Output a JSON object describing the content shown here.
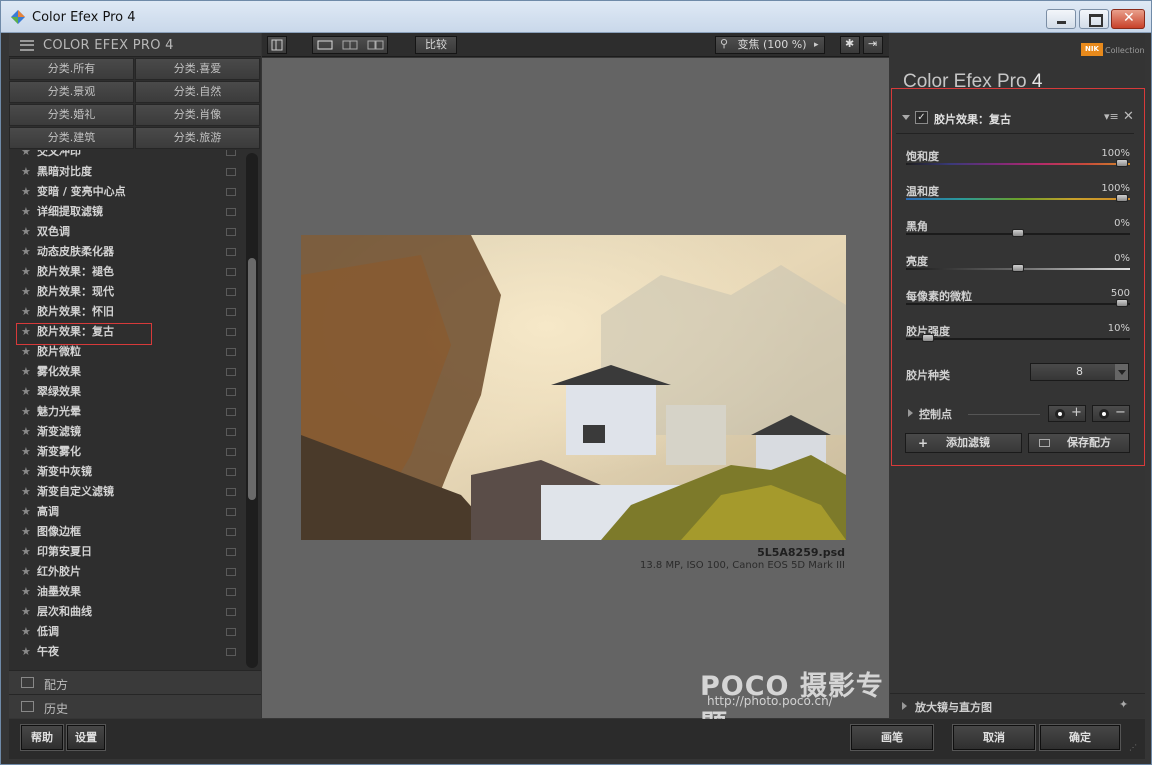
{
  "window": {
    "title": "Color Efex Pro 4"
  },
  "left_panel": {
    "title": "COLOR EFEX PRO 4",
    "categories": [
      "分类.所有",
      "分类.喜爱",
      "分类.景观",
      "分类.自然",
      "分类.婚礼",
      "分类.肖像",
      "分类.建筑",
      "分类.旅游"
    ],
    "filters": [
      "交叉冲印",
      "黑暗对比度",
      "变暗 / 变亮中心点",
      "详细提取滤镜",
      "双色调",
      "动态皮肤柔化器",
      "胶片效果：褪色",
      "胶片效果：现代",
      "胶片效果：怀旧",
      "胶片效果：复古",
      "胶片微粒",
      "雾化效果",
      "翠绿效果",
      "魅力光晕",
      "渐变滤镜",
      "渐变雾化",
      "渐变中灰镜",
      "渐变自定义滤镜",
      "高调",
      "图像边框",
      "印第安夏日",
      "红外胶片",
      "油墨效果",
      "层次和曲线",
      "低调",
      "午夜"
    ],
    "selected_filter": "胶片效果：复古",
    "sections": {
      "recipes": "配方",
      "history": "历史"
    }
  },
  "toolbar": {
    "compare": "比较",
    "zoom": "变焦 (100 %)"
  },
  "preview": {
    "file_name": "5L5A8259.psd",
    "file_info": "13.8 MP, ISO 100, Canon EOS 5D Mark III",
    "watermark": "POCO 摄影专题",
    "watermark_url": "http://photo.poco.cn/"
  },
  "right_panel": {
    "brand": "NIK",
    "brand_sub": "Collection",
    "app_title_main": "Color Efex Pro",
    "app_title_num": "4",
    "filter_name": "胶片效果：复古",
    "filter_enabled": true,
    "sliders": [
      {
        "name": "饱和度",
        "value": "100%",
        "level": 1.0,
        "gradient": "saturation"
      },
      {
        "name": "温和度",
        "value": "100%",
        "level": 1.0,
        "gradient": "warmth"
      },
      {
        "name": "黑角",
        "value": "0%",
        "level": 0.5,
        "gradient": "none"
      },
      {
        "name": "亮度",
        "value": "0%",
        "level": 0.5,
        "gradient": "brightness"
      },
      {
        "name": "每像素的微粒",
        "value": "500",
        "level": 1.0,
        "gradient": "none"
      },
      {
        "name": "胶片强度",
        "value": "10%",
        "level": 0.1,
        "gradient": "none"
      }
    ],
    "film_type_label": "胶片种类",
    "film_type_value": "8",
    "control_points": "控制点",
    "add_filter": "添加滤镜",
    "save_recipe": "保存配方",
    "loupe": "放大镜与直方图"
  },
  "bottom": {
    "help": "帮助",
    "settings": "设置",
    "brush": "画笔",
    "cancel": "取消",
    "ok": "确定"
  },
  "colors": {
    "accent_red": "#d73a3a",
    "panel_bg": "#343434",
    "preview_bg": "#646464"
  }
}
